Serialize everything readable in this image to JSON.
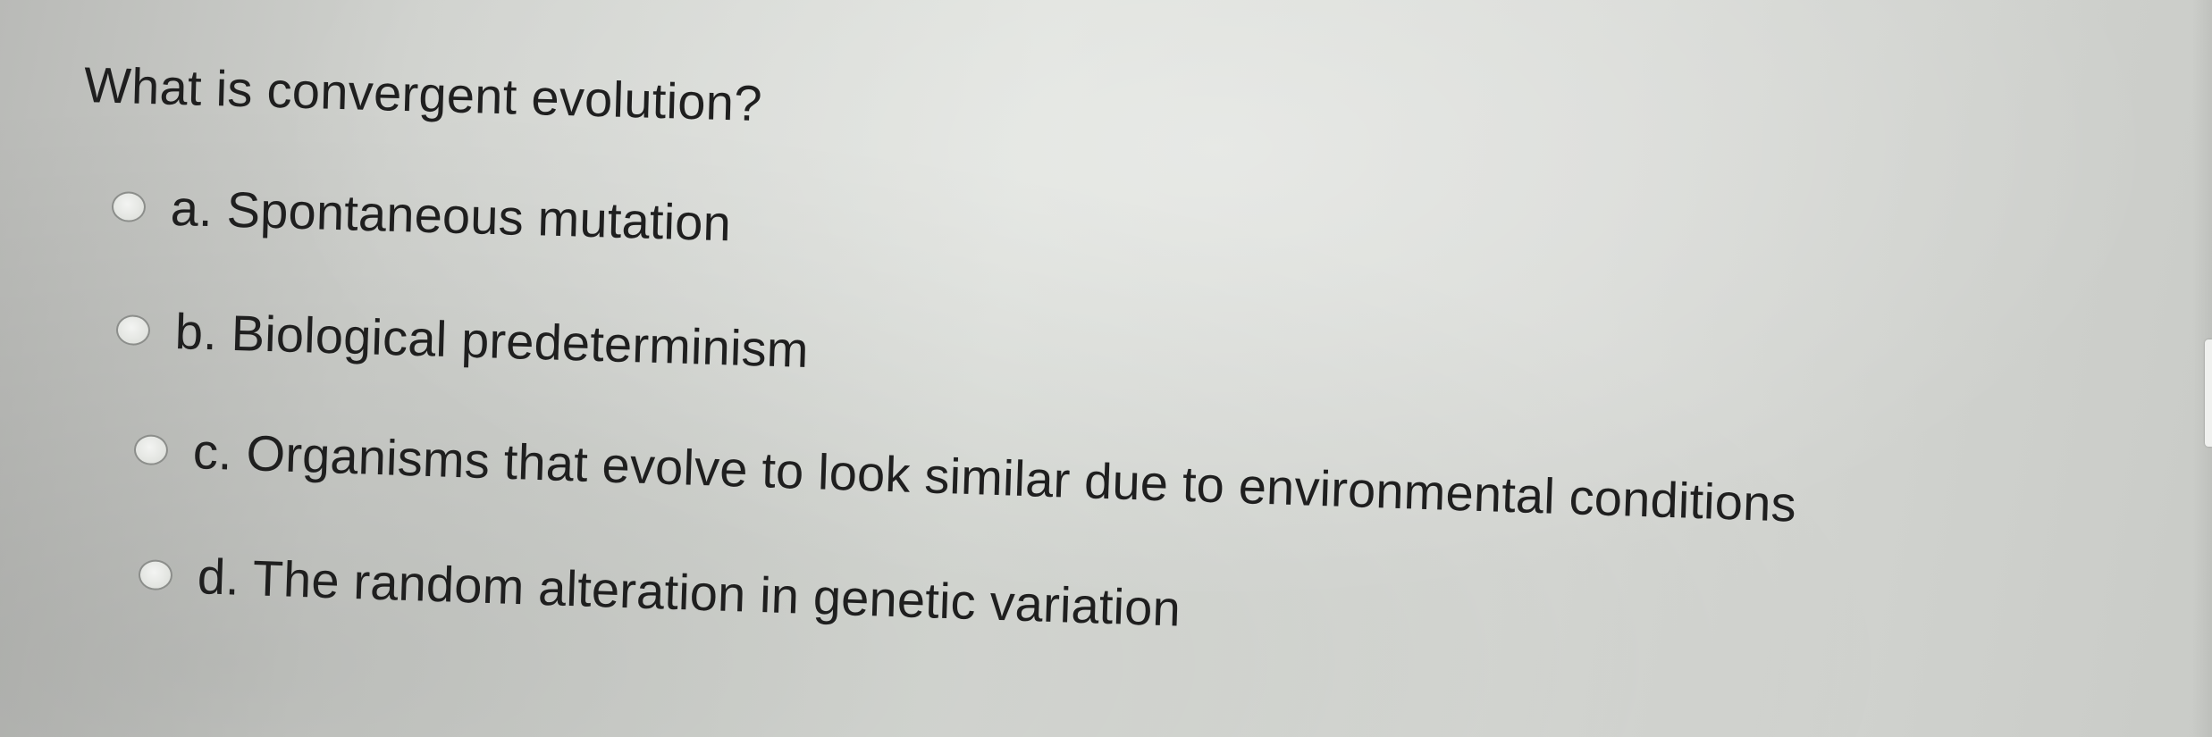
{
  "question": {
    "text": "What is convergent evolution?"
  },
  "options": [
    {
      "label": "a. Spontaneous mutation",
      "selected": false
    },
    {
      "label": "b. Biological predeterminism",
      "selected": false
    },
    {
      "label": "c. Organisms that evolve to look similar due to environmental conditions",
      "selected": false
    },
    {
      "label": "d. The random alteration in genetic variation",
      "selected": false
    }
  ],
  "icons": {
    "radio": "radio-button-icon"
  }
}
